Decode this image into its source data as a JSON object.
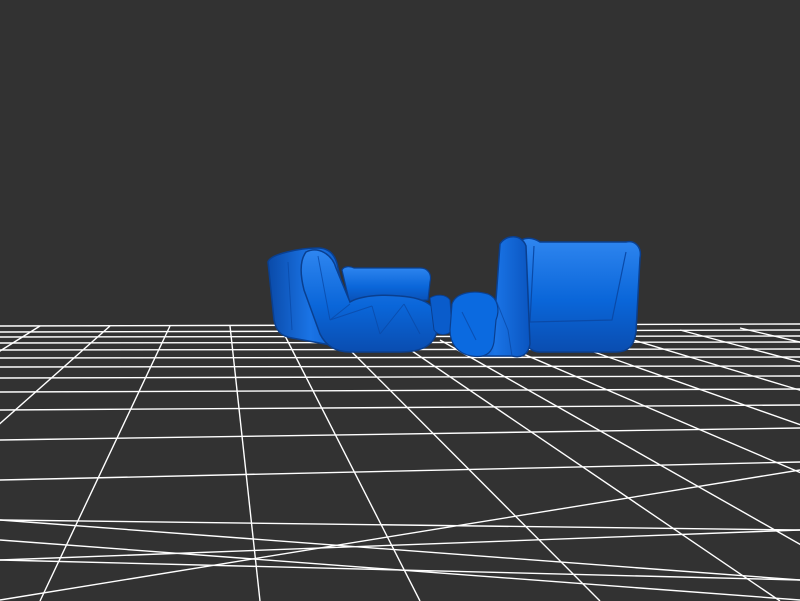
{
  "scene": {
    "background_color": "#323232",
    "grid_color": "#ffffff",
    "model_color": "#0a66d9",
    "model_highlight_color": "#2f86f0",
    "model_shadow_color": "#0a3f8f",
    "objects": [
      {
        "name": "left-armchair"
      },
      {
        "name": "right-armchair"
      }
    ]
  }
}
